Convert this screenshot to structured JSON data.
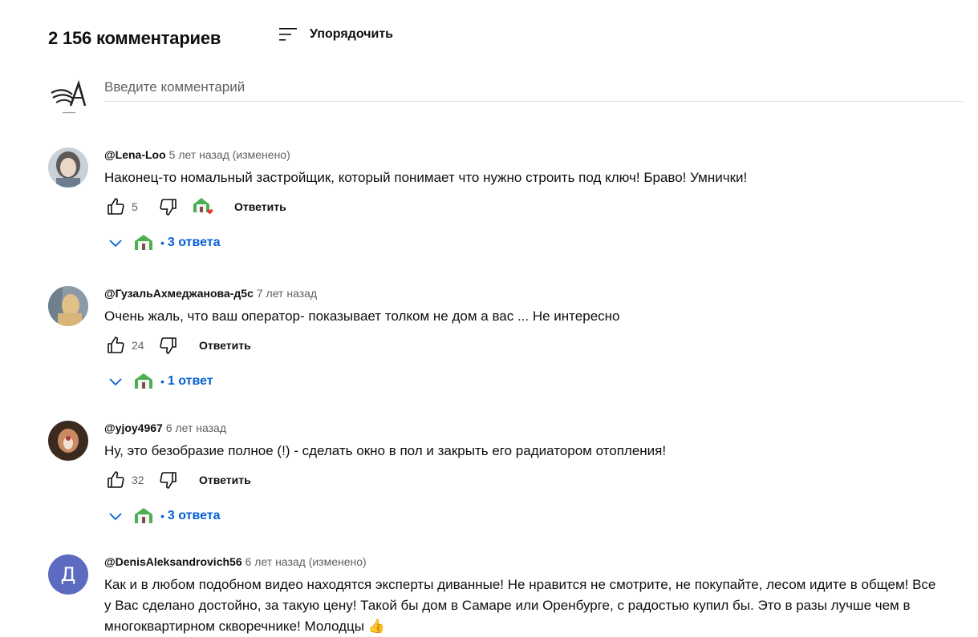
{
  "header": {
    "count_label": "2 156 комментариев",
    "sort_label": "Упорядочить"
  },
  "composer": {
    "placeholder": "Введите комментарий"
  },
  "comments": [
    {
      "author": "@Lena-Loo",
      "time": "5 лет назад (изменено)",
      "text": "Наконец-то номальный застройщик, который понимает что нужно строить под ключ! Браво! Умнички!",
      "likes": "5",
      "reply_label": "Ответить",
      "replies_label": "3 ответа",
      "creator_heart": true
    },
    {
      "author": "@ГузальАхмеджанова-д5с",
      "time": "7 лет назад",
      "text": "Очень жаль, что ваш оператор- показывает  толком не дом а вас ... Не интересно",
      "likes": "24",
      "reply_label": "Ответить",
      "replies_label": "1 ответ"
    },
    {
      "author": "@yjoy4967",
      "time": "6 лет назад",
      "text": "Ну, это безобразие полное (!) - сделать окно в пол и закрыть его радиатором отопления!",
      "likes": "32",
      "reply_label": "Ответить",
      "replies_label": "3 ответа"
    },
    {
      "author": "@DenisAleksandrovich56",
      "time": "6 лет назад (изменено)",
      "avatar_letter": "Д",
      "text": "Как и в любом подобном видео находятся эксперты диванные! Не нравится не смотрите, не покупайте, лесом идите в общем! Все у Вас сделано достойно, за такую цену! Такой бы дом в Самаре или Оренбурге, с радостью купил бы. Это в разы лучше чем в многоквартирном скворечнике! Молодцы 👍"
    }
  ],
  "colors": {
    "link_blue": "#065fd4",
    "secondary_text": "#606060",
    "avatar_letter_bg": "#5c6bc0",
    "heart_red": "#e53935"
  },
  "icons": {
    "sort": "sort-icon",
    "like": "thumb-up-icon",
    "dislike": "thumb-down-icon",
    "more": "more-vert-icon",
    "expand": "chevron-down-icon"
  }
}
